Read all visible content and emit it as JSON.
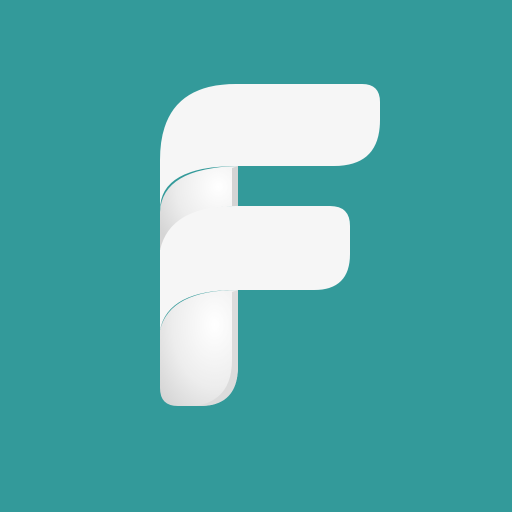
{
  "app_icon": {
    "name": "F",
    "colors": {
      "background": "#339a9a",
      "letter": "#f6f6f6",
      "letter_shadow": "#d0d0d0",
      "fold_highlight": "#ffffff"
    },
    "icon": "letter-f-logo-icon"
  }
}
